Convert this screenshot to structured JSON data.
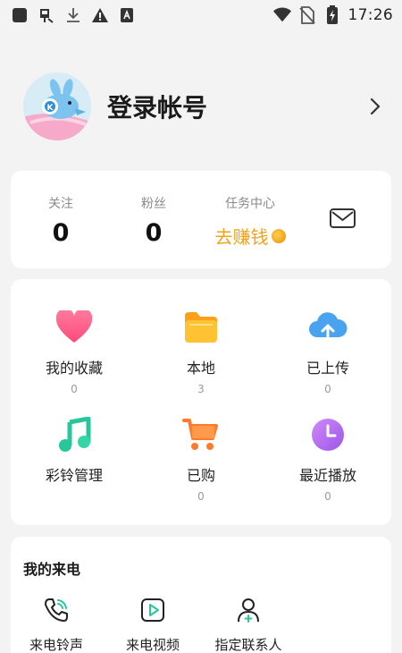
{
  "status_bar": {
    "time": "17:26",
    "icons": [
      "app-square-icon",
      "bug-icon",
      "download-icon",
      "warning-icon",
      "font-a-icon",
      "wifi-icon",
      "no-sim-icon",
      "battery-charging-icon"
    ]
  },
  "profile": {
    "login_label": "登录帐号",
    "avatar_icon": "kugou-mascot-avatar",
    "chevron_icon": "chevron-right-icon"
  },
  "stats": {
    "following": {
      "label": "关注",
      "value": "0"
    },
    "fans": {
      "label": "粉丝",
      "value": "0"
    },
    "tasks": {
      "label": "任务中心",
      "action": "去赚钱",
      "icon": "coin-icon"
    },
    "mail_icon": "mail-icon"
  },
  "features": [
    {
      "label": "我的收藏",
      "count": "0",
      "icon": "heart-icon",
      "color": "#ff5a86"
    },
    {
      "label": "本地",
      "count": "3",
      "icon": "folder-icon",
      "color": "#ffb322"
    },
    {
      "label": "已上传",
      "count": "0",
      "icon": "cloud-upload-icon",
      "color": "#4aa3ef"
    },
    {
      "label": "彩铃管理",
      "count": "",
      "icon": "music-note-icon",
      "color": "#28c79a"
    },
    {
      "label": "已购",
      "count": "0",
      "icon": "cart-icon",
      "color": "#ff7a2a"
    },
    {
      "label": "最近播放",
      "count": "0",
      "icon": "clock-icon",
      "color": "#b36df0"
    }
  ],
  "incoming_call": {
    "title": "我的来电",
    "items": [
      {
        "label": "来电铃声",
        "icon": "phone-ring-icon"
      },
      {
        "label": "来电视频",
        "icon": "video-play-icon"
      },
      {
        "label": "指定联系人",
        "icon": "add-contact-icon"
      }
    ]
  },
  "colors": {
    "background": "#f3f3f3",
    "card": "#ffffff",
    "accent_orange": "#f2a21a"
  }
}
